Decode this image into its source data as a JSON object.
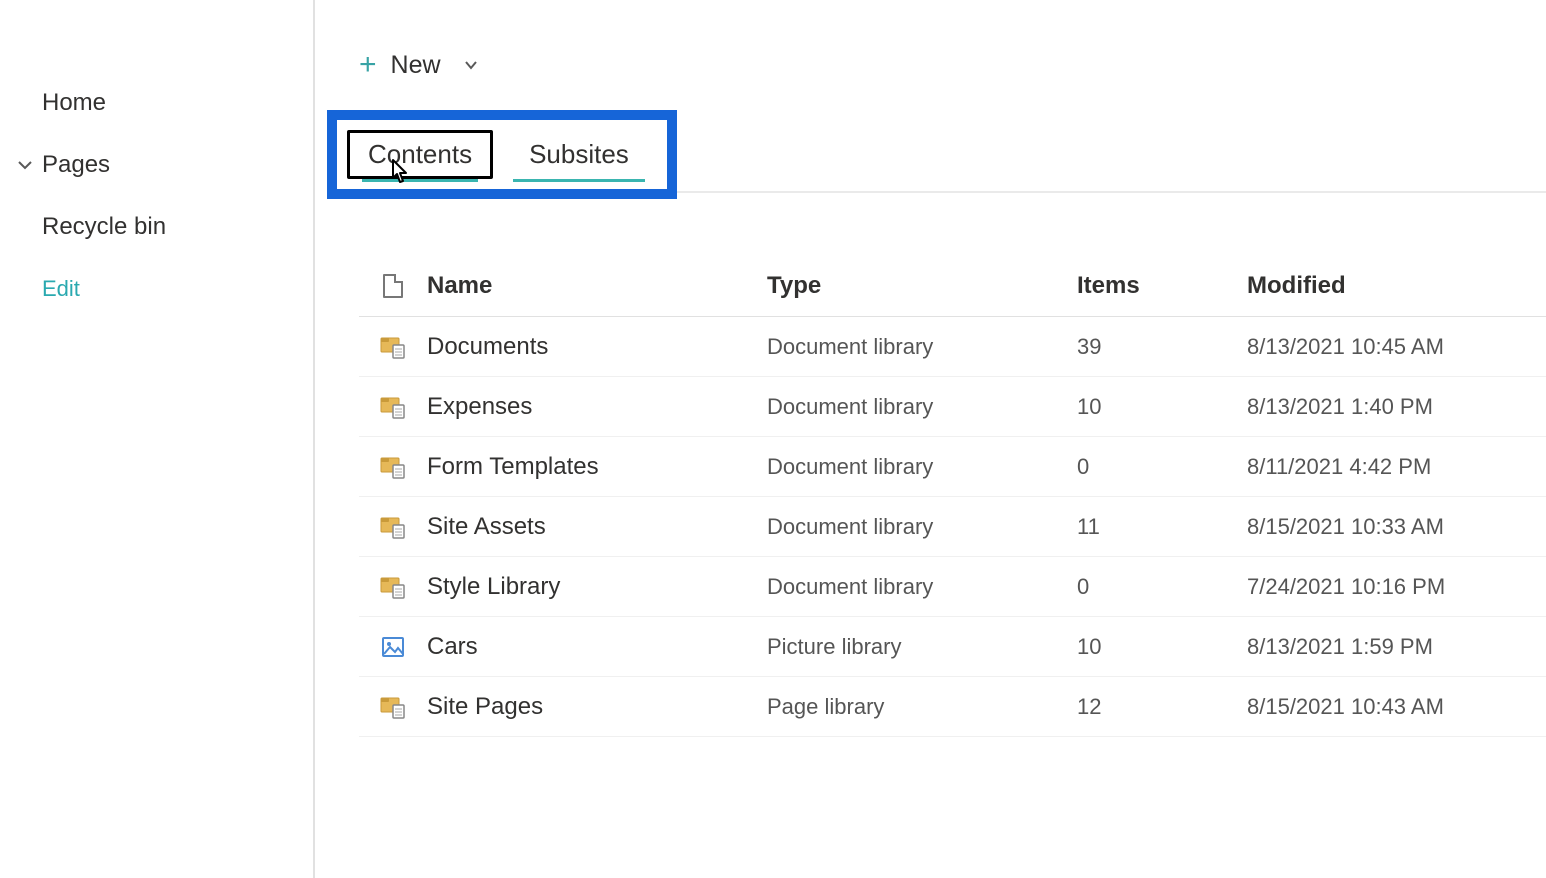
{
  "sidebar": {
    "items": [
      {
        "label": "Home"
      },
      {
        "label": "Pages",
        "expandable": true
      },
      {
        "label": "Recycle bin"
      }
    ],
    "edit_label": "Edit"
  },
  "toolbar": {
    "new_label": "New"
  },
  "tabs": {
    "contents_label": "Contents",
    "subsites_label": "Subsites"
  },
  "table": {
    "headers": {
      "name": "Name",
      "type": "Type",
      "items": "Items",
      "modified": "Modified"
    },
    "rows": [
      {
        "icon": "doclib",
        "name": "Documents",
        "type": "Document library",
        "items": "39",
        "modified": "8/13/2021 10:45 AM"
      },
      {
        "icon": "doclib",
        "name": "Expenses",
        "type": "Document library",
        "items": "10",
        "modified": "8/13/2021 1:40 PM"
      },
      {
        "icon": "doclib",
        "name": "Form Templates",
        "type": "Document library",
        "items": "0",
        "modified": "8/11/2021 4:42 PM"
      },
      {
        "icon": "doclib",
        "name": "Site Assets",
        "type": "Document library",
        "items": "11",
        "modified": "8/15/2021 10:33 AM"
      },
      {
        "icon": "doclib",
        "name": "Style Library",
        "type": "Document library",
        "items": "0",
        "modified": "7/24/2021 10:16 PM"
      },
      {
        "icon": "piclib",
        "name": "Cars",
        "type": "Picture library",
        "items": "10",
        "modified": "8/13/2021 1:59 PM"
      },
      {
        "icon": "doclib",
        "name": "Site Pages",
        "type": "Page library",
        "items": "12",
        "modified": "8/15/2021 10:43 AM"
      }
    ]
  }
}
